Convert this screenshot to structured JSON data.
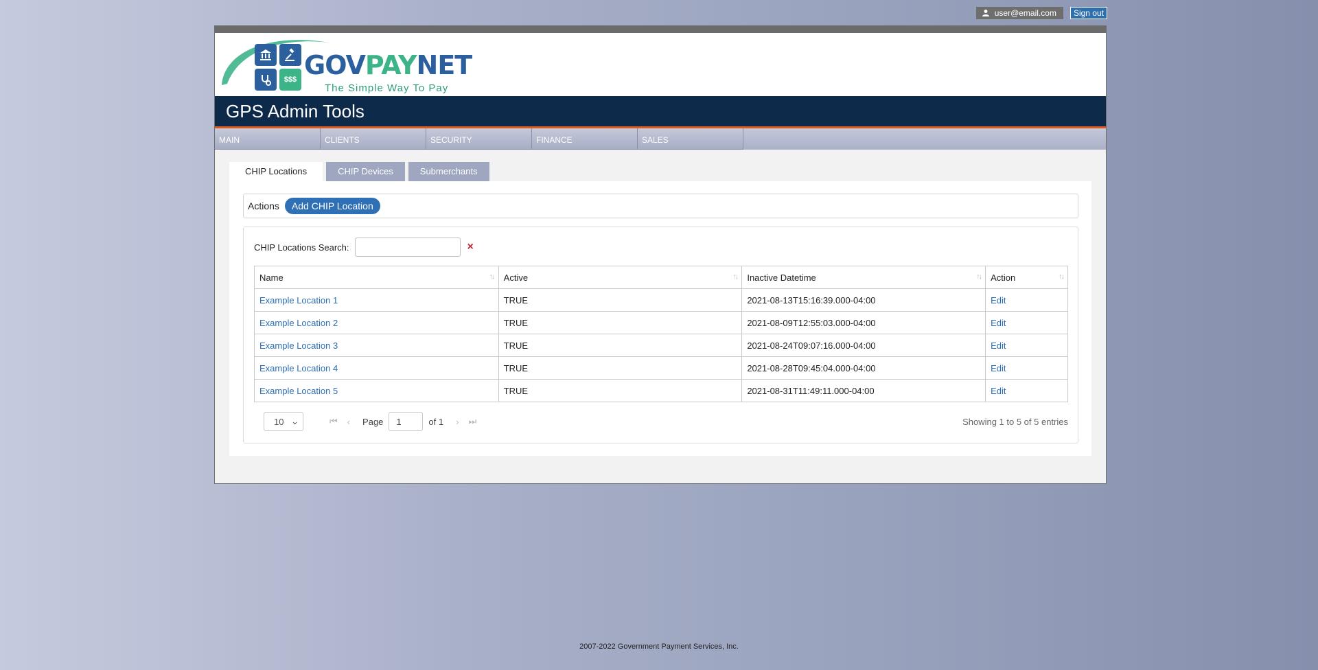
{
  "user": {
    "email": "user@email.com",
    "signout_label": "Sign out"
  },
  "logo": {
    "gov": "GOV",
    "pay": "PAY",
    "net": "NET",
    "tagline": "The Simple Way To Pay",
    "money_tile": "$$$"
  },
  "app_title": "GPS Admin Tools",
  "nav": [
    "MAIN",
    "CLIENTS",
    "SECURITY",
    "FINANCE",
    "SALES"
  ],
  "tabs": [
    {
      "label": "CHIP Locations",
      "active": true
    },
    {
      "label": "CHIP Devices",
      "active": false
    },
    {
      "label": "Submerchants",
      "active": false
    }
  ],
  "actions": {
    "label": "Actions",
    "add_button": "Add CHIP Location"
  },
  "search": {
    "label": "CHIP Locations Search:",
    "value": "",
    "clear_icon": "×"
  },
  "table": {
    "columns": [
      "Name",
      "Active",
      "Inactive Datetime",
      "Action"
    ],
    "rows": [
      {
        "name": "Example Location 1",
        "active": "TRUE",
        "inactive": "2021-08-13T15:16:39.000-04:00",
        "action": "Edit"
      },
      {
        "name": "Example Location 2",
        "active": "TRUE",
        "inactive": "2021-08-09T12:55:03.000-04:00",
        "action": "Edit"
      },
      {
        "name": "Example Location 3",
        "active": "TRUE",
        "inactive": "2021-08-24T09:07:16.000-04:00",
        "action": "Edit"
      },
      {
        "name": "Example Location 4",
        "active": "TRUE",
        "inactive": "2021-08-28T09:45:04.000-04:00",
        "action": "Edit"
      },
      {
        "name": "Example Location 5",
        "active": "TRUE",
        "inactive": "2021-08-31T11:49:11.000-04:00",
        "action": "Edit"
      }
    ]
  },
  "pager": {
    "page_size": "10",
    "page_label": "Page",
    "page_value": "1",
    "of_label": "of 1",
    "showing": "Showing 1 to 5 of 5 entries"
  },
  "footer": "2007-2022 Government Payment Services, Inc.",
  "colors": {
    "title_bar": "#0e2a4a",
    "accent_orange": "#e05a1e",
    "link_blue": "#2c6db5",
    "brand_green": "#3db488"
  }
}
